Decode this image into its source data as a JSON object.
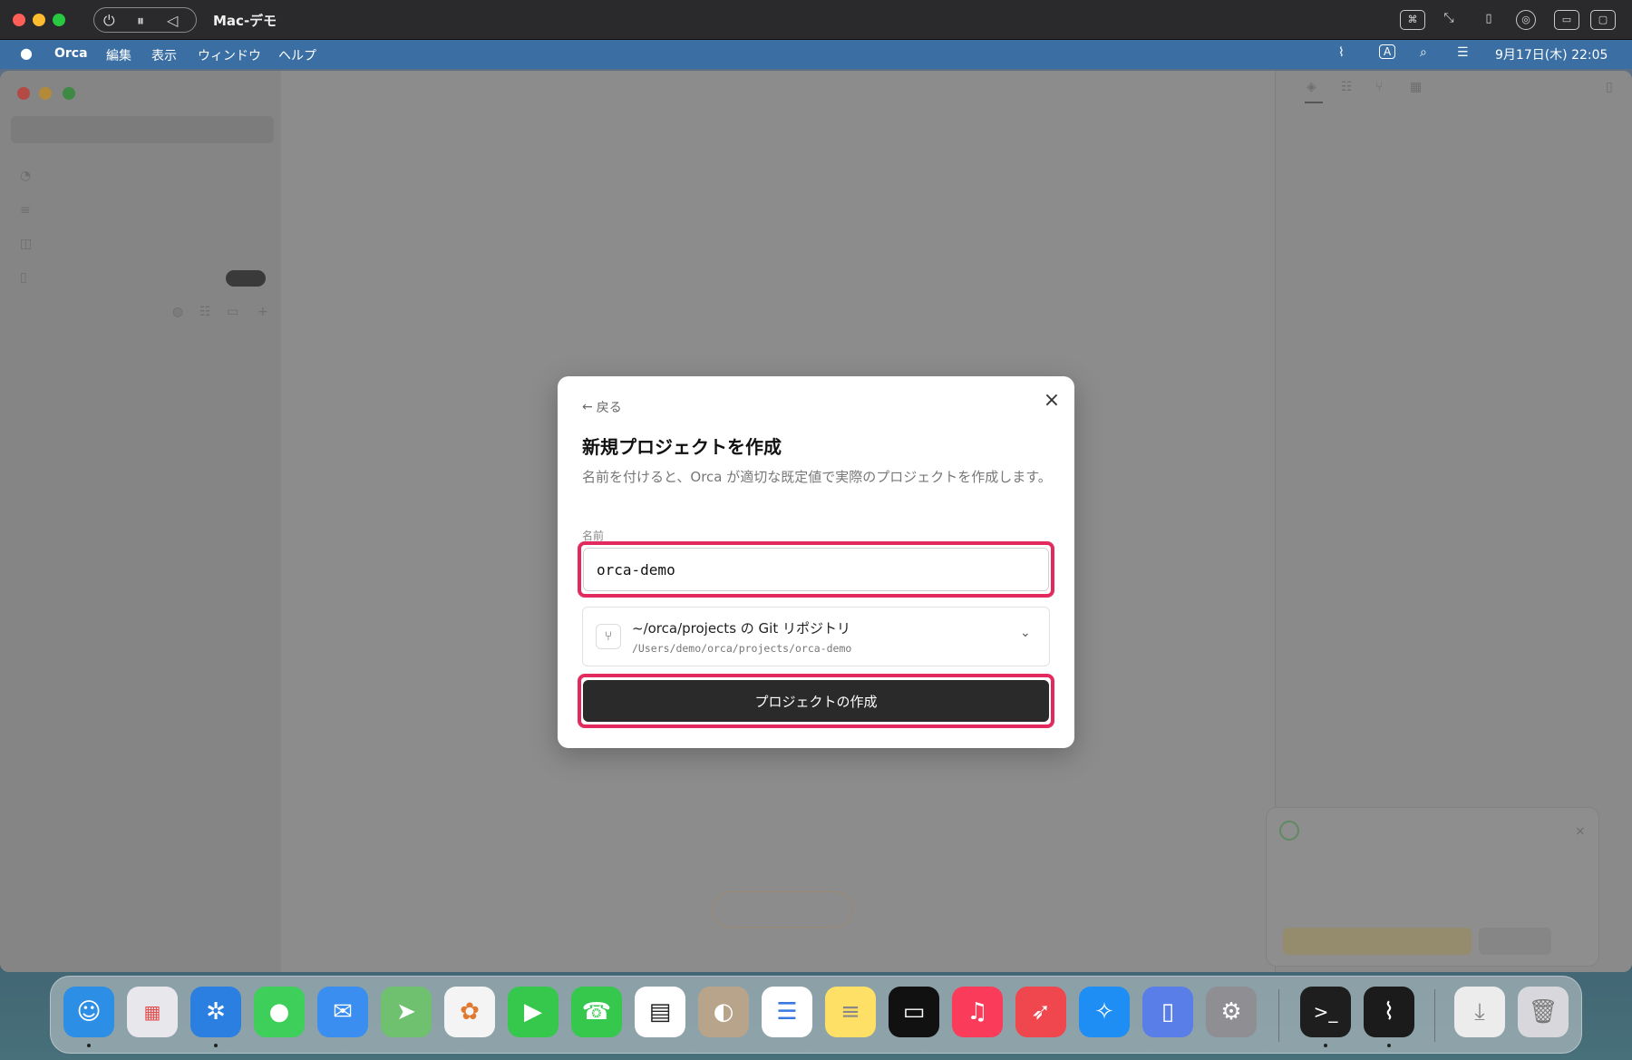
{
  "vm": {
    "title": "Mac-デモ",
    "icons": [
      "power-icon",
      "pause-icon",
      "back-triangle-icon",
      "command-icon",
      "resize-icon",
      "mouse-icon",
      "network-icon",
      "folder-icon",
      "window-icon"
    ]
  },
  "menubar": {
    "app_name": "Orca",
    "items": [
      "編集",
      "表示",
      "ウィンドウ",
      "ヘルプ"
    ],
    "input_mode": "A",
    "datetime": "9月17日(木)  22:05"
  },
  "dialog": {
    "back_label": "戻る",
    "close_icon": "×",
    "title": "新規プロジェクトを作成",
    "description": "名前を付けると、Orca が適切な既定値で実際のプロジェクトを作成します。",
    "name_label": "名前",
    "name_value": "orca-demo",
    "repo_title": "~/orca/projects の Git リポジトリ",
    "repo_path": "/Users/demo/orca/projects/orca-demo",
    "create_label": "プロジェクトの作成"
  },
  "colors": {
    "highlight": "#e22a5f",
    "button": "#2a2a2a",
    "menubar": "#3b6fa3"
  }
}
